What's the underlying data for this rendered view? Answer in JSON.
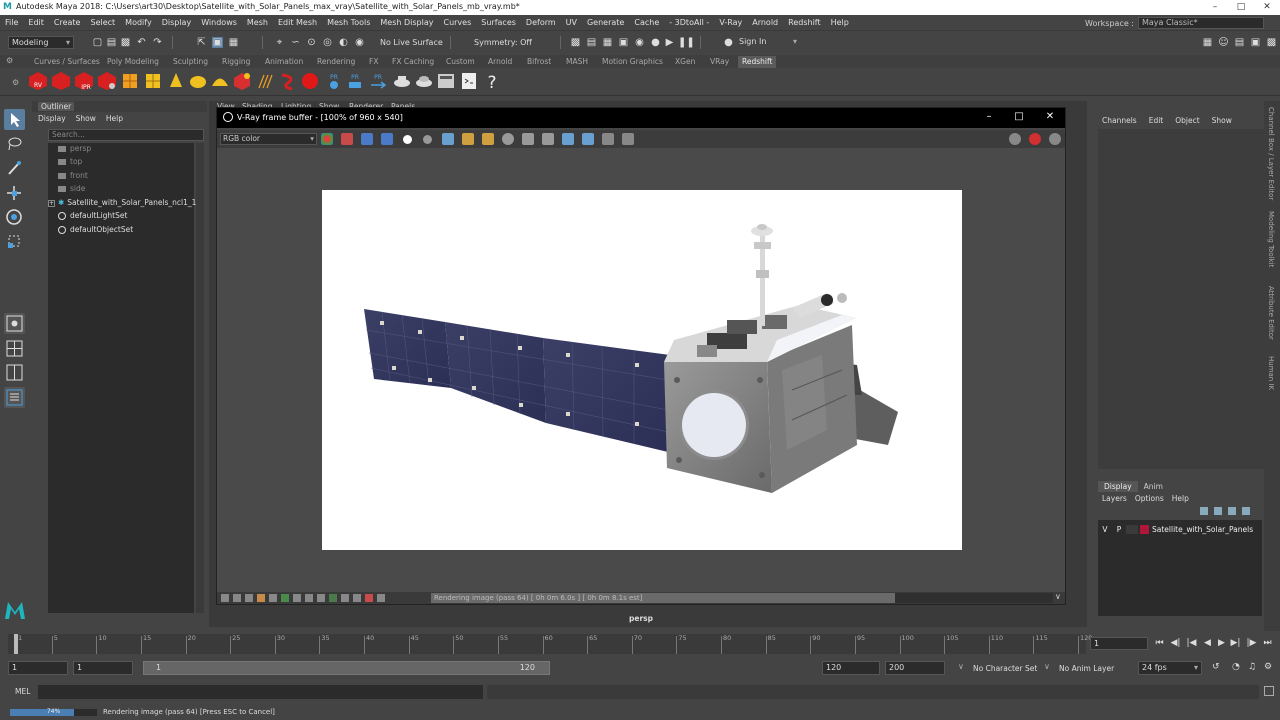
{
  "window": {
    "title": "Autodesk Maya 2018: C:\\Users\\art30\\Desktop\\Satellite_with_Solar_Panels_max_vray\\Satellite_with_Solar_Panels_mb_vray.mb*",
    "logo_letter": "M"
  },
  "menubar": {
    "items": [
      "File",
      "Edit",
      "Create",
      "Select",
      "Modify",
      "Display",
      "Windows",
      "Mesh",
      "Edit Mesh",
      "Mesh Tools",
      "Mesh Display",
      "Curves",
      "Surfaces",
      "Deform",
      "UV",
      "Generate",
      "Cache",
      "- 3DtoAll -",
      "V-Ray",
      "Arnold",
      "Redshift",
      "Help"
    ],
    "workspace_label": "Workspace :",
    "workspace_value": "Maya Classic*"
  },
  "statusline": {
    "mode": "Modeling",
    "live_surface": "No Live Surface",
    "symmetry": "Symmetry: Off",
    "sign_in": "Sign In"
  },
  "shelf": {
    "tabs": [
      "Curves / Surfaces",
      "Poly Modeling",
      "Sculpting",
      "Rigging",
      "Animation",
      "Rendering",
      "FX",
      "FX Caching",
      "Custom",
      "Arnold",
      "Bifrost",
      "MASH",
      "Motion Graphics",
      "XGen",
      "VRay",
      "Redshift"
    ],
    "active_tab": "Redshift",
    "labels": [
      "RV",
      "IPR",
      "PR",
      "PR",
      "PR"
    ]
  },
  "outliner": {
    "title": "Outliner",
    "menu": [
      "Display",
      "Show",
      "Help"
    ],
    "search_placeholder": "Search...",
    "items": [
      "persp",
      "top",
      "front",
      "side",
      "Satellite_with_Solar_Panels_ncl1_1",
      "defaultLightSet",
      "defaultObjectSet"
    ]
  },
  "viewport": {
    "menu": [
      "View",
      "Shading",
      "Lighting",
      "Show",
      "Renderer",
      "Panels"
    ],
    "camera_label": "persp"
  },
  "vfb": {
    "title": "V-Ray frame buffer - [100% of 960 x 540]",
    "channel": "RGB color",
    "status": "Rendering image (pass 64) [ 0h  0m  6.0s ] [ 0h  0m  8.1s est]",
    "progress": 0.74
  },
  "channelbox": {
    "menu": [
      "Channels",
      "Edit",
      "Object",
      "Show"
    ]
  },
  "sidetabs": [
    "Channel Box / Layer Editor",
    "Modeling Toolkit",
    "Attribute Editor",
    "Human IK"
  ],
  "layers": {
    "tabs": [
      "Display",
      "Anim"
    ],
    "active_tab": "Display",
    "menu": [
      "Layers",
      "Options",
      "Help"
    ],
    "row": {
      "v": "V",
      "p": "P",
      "name": "Satellite_with_Solar_Panels",
      "color": "#b0153a"
    }
  },
  "timeslider": {
    "ticks": [
      "1",
      "5",
      "10",
      "15",
      "20",
      "25",
      "30",
      "35",
      "40",
      "45",
      "50",
      "55",
      "60",
      "65",
      "70",
      "75",
      "80",
      "85",
      "90",
      "95",
      "100",
      "105",
      "110",
      "115",
      "120"
    ],
    "current_frame": "1"
  },
  "range": {
    "start": "1",
    "inner_start": "1",
    "bar_start": "1",
    "bar_end": "120",
    "end": "120",
    "anim_end": "200",
    "character_set": "No Character Set",
    "anim_layer": "No Anim Layer",
    "fps": "24 fps"
  },
  "cmdline": {
    "label": "MEL"
  },
  "helpline": {
    "progress_text": "74%",
    "progress": 0.74,
    "message": "Rendering image (pass 64) [Press ESC to Cancel]"
  }
}
